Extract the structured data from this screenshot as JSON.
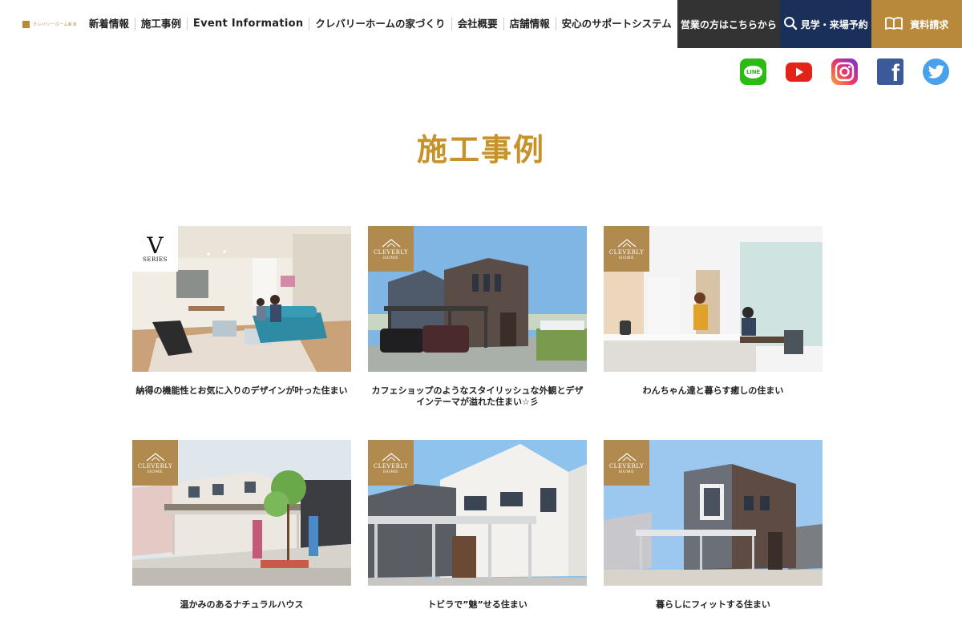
{
  "header": {
    "logo_text": "クレバリーホーム新潟",
    "nav": [
      {
        "label": "新着情報"
      },
      {
        "label": "施工事例"
      },
      {
        "label": "Event Information"
      },
      {
        "label": "クレバリーホームの家づくり"
      },
      {
        "label": "会社概要"
      },
      {
        "label": "店舗情報"
      },
      {
        "label": "安心のサポートシステム"
      }
    ],
    "sales_label": "営業の方はこちらから",
    "visit_label": "見学・来場予約",
    "request_label": "資料請求"
  },
  "social": {
    "line_label": "LINE"
  },
  "page": {
    "title": "施工事例"
  },
  "badges": {
    "cleverly_top": "CLEVERLY",
    "cleverly_sub": "HOME",
    "v_letter": "V",
    "v_series": "SERIES"
  },
  "works": [
    {
      "title": "納得の機能性とお気に入りのデザインが叶った住まい",
      "badge": "v-series"
    },
    {
      "title": "カフェショップのようなスタイリッシュな外観とデザインテーマが溢れた住まい☆彡",
      "badge": "cleverly"
    },
    {
      "title": "わんちゃん達と暮らす癒しの住まい",
      "badge": "cleverly"
    },
    {
      "title": "温かみのあるナチュラルハウス",
      "badge": "cleverly"
    },
    {
      "title": "トビラで”魅”せる住まい",
      "badge": "cleverly"
    },
    {
      "title": "暮らしにフィットする住まい",
      "badge": "cleverly"
    }
  ],
  "colors": {
    "accent_gold": "#c8922a",
    "navy": "#1a2f5a",
    "dark": "#333333"
  }
}
